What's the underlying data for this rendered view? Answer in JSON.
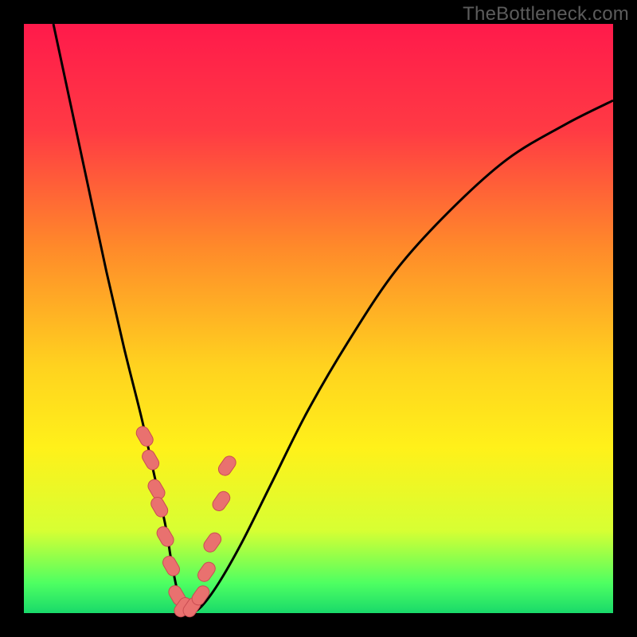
{
  "watermark": "TheBottleneck.com",
  "colors": {
    "frame": "#000000",
    "gradient_stops": [
      {
        "pct": 0,
        "color": "#ff1a4b"
      },
      {
        "pct": 18,
        "color": "#ff3a44"
      },
      {
        "pct": 38,
        "color": "#ff8a2a"
      },
      {
        "pct": 58,
        "color": "#ffd21f"
      },
      {
        "pct": 72,
        "color": "#fff11a"
      },
      {
        "pct": 86,
        "color": "#d7ff33"
      },
      {
        "pct": 95,
        "color": "#4dff62"
      },
      {
        "pct": 100,
        "color": "#19d96a"
      }
    ],
    "curve": "#000000",
    "marker_fill": "#e9716f",
    "marker_stroke": "#c94d52"
  },
  "chart_data": {
    "type": "line",
    "title": "",
    "xlabel": "",
    "ylabel": "",
    "xlim": [
      0,
      100
    ],
    "ylim": [
      0,
      100
    ],
    "series": [
      {
        "name": "bottleneck-curve",
        "x": [
          5,
          8,
          11,
          14,
          17,
          20,
          22,
          24,
          25,
          26,
          27,
          28,
          30,
          33,
          37,
          42,
          48,
          55,
          63,
          72,
          82,
          92,
          100
        ],
        "y": [
          100,
          86,
          72,
          58,
          45,
          33,
          24,
          15,
          9,
          4,
          1,
          0,
          1,
          5,
          12,
          22,
          34,
          46,
          58,
          68,
          77,
          83,
          87
        ]
      }
    ],
    "markers": {
      "name": "highlight-points",
      "x": [
        20.5,
        21.5,
        22.5,
        23.0,
        24.0,
        25.0,
        26.0,
        27.0,
        28.5,
        30.0,
        31.0,
        32.0,
        33.5,
        34.5
      ],
      "y": [
        30,
        26,
        21,
        18,
        13,
        8,
        3,
        1,
        1,
        3,
        7,
        12,
        19,
        25
      ]
    }
  }
}
